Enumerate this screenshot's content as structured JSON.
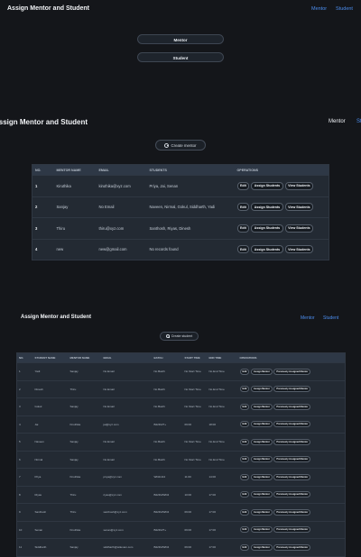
{
  "top": {
    "title": "Assign Mentor and Student",
    "nav": [
      "Mentor",
      "Student"
    ],
    "buttons": [
      "Mentor",
      "Student"
    ]
  },
  "mentor_page": {
    "title": "Assign Mentor and Student",
    "nav": [
      "Mentor",
      "St"
    ],
    "create_label": "Create mentor",
    "headers": [
      "NO.",
      "MENTOR NAME",
      "EMAIL",
      "STUDENTS",
      "OPERATIONS"
    ],
    "actions": [
      "Edit",
      "Assign Students",
      "View Students"
    ],
    "rows": [
      {
        "no": "1",
        "name": "Kiruthika",
        "email": "kiruthika@xyz.com",
        "students": "Priya, Jai, Senan"
      },
      {
        "no": "2",
        "name": "Sanjay",
        "email": "No Email",
        "students": "Naveen, Nirmal, Gokul, Siddharth, Yadi"
      },
      {
        "no": "3",
        "name": "Thiru",
        "email": "thiru@xyz.com",
        "students": "Santhosh, Riyas, Dinesh"
      },
      {
        "no": "4",
        "name": "new",
        "email": "new@gmail.com",
        "students": "No records found"
      }
    ]
  },
  "student_page": {
    "title": "Assign Mentor and Student",
    "nav": [
      "Mentor",
      "Student"
    ],
    "create_label": "Create student",
    "headers": [
      "NO.",
      "STUDENT NAME",
      "MENTOR NAME",
      "EMAIL",
      "BATCH",
      "START TIME",
      "END TIME",
      "OPERATIONS"
    ],
    "actions": [
      "Edit",
      "Assign Mentor",
      "Previously Assigned Mentor"
    ],
    "rows": [
      {
        "no": "1",
        "name": "Yadi",
        "mentor": "Sanjay",
        "email": "No Email",
        "batch": "No Batch",
        "start": "No Start Time",
        "end": "No End Time"
      },
      {
        "no": "2",
        "name": "Dinesh",
        "mentor": "Thiru",
        "email": "No Email",
        "batch": "No Batch",
        "start": "No Start Time",
        "end": "No End Time"
      },
      {
        "no": "3",
        "name": "Gokul",
        "mentor": "Sanjay",
        "email": "No Email",
        "batch": "No Batch",
        "start": "No Start Time",
        "end": "No End Time"
      },
      {
        "no": "4",
        "name": "Jai",
        "mentor": "Kiruthika",
        "email": "jai@xyz.com",
        "batch": "B22D4/T+",
        "start": "09:00",
        "end": "18:00"
      },
      {
        "no": "5",
        "name": "Naveen",
        "mentor": "Sanjay",
        "email": "No Email",
        "batch": "No Batch",
        "start": "No Start Time",
        "end": "No End Time"
      },
      {
        "no": "6",
        "name": "Nirmal",
        "mentor": "Sanjay",
        "email": "No Email",
        "batch": "No Batch",
        "start": "No Start Time",
        "end": "No End Time"
      },
      {
        "no": "7",
        "name": "Priya",
        "mentor": "Kiruthika",
        "email": "priya@xyz.com",
        "batch": "WD21/24",
        "start": "11:00",
        "end": "14:00"
      },
      {
        "no": "8",
        "name": "Riyas",
        "mentor": "Thiru",
        "email": "riyas@xyz.com",
        "batch": "B22D4/WD4",
        "start": "10:00",
        "end": "17:00"
      },
      {
        "no": "9",
        "name": "Santhosh",
        "mentor": "Thiru",
        "email": "santhosh@xyz.com",
        "batch": "B22D4/WD4",
        "start": "09:00",
        "end": "17:00"
      },
      {
        "no": "10",
        "name": "Senan",
        "mentor": "Kiruthika",
        "email": "senan@xyz.com",
        "batch": "B22D4/T+",
        "start": "09:00",
        "end": "17:00"
      },
      {
        "no": "11",
        "name": "Siddharth",
        "mentor": "Sanjay",
        "email": "siddharth@wtlexam.com",
        "batch": "B22D4/WD4",
        "start": "09:00",
        "end": "17:00"
      }
    ]
  }
}
